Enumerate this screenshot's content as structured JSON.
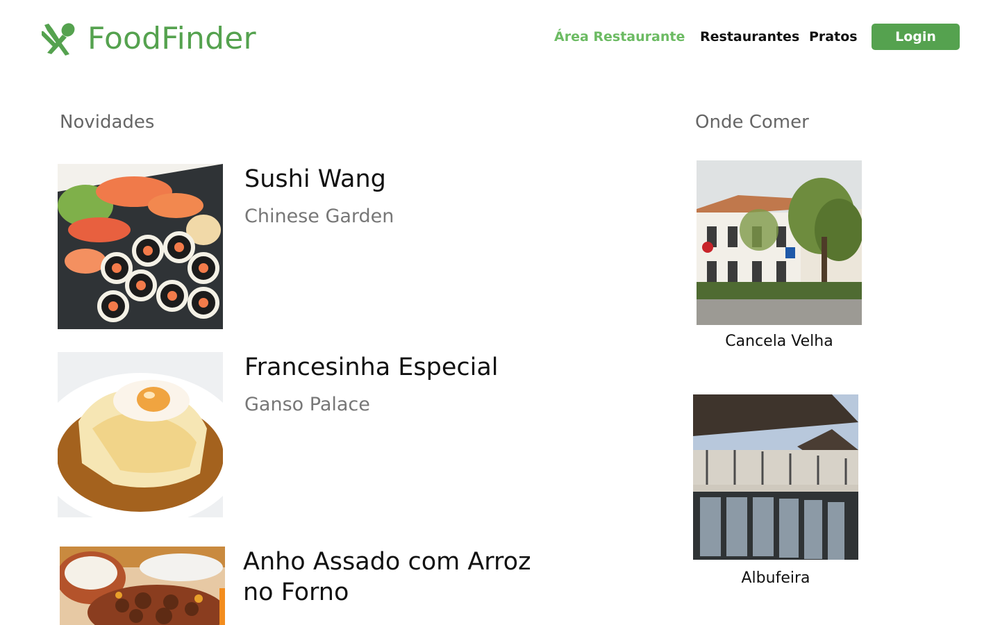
{
  "brand": {
    "name": "FoodFinder",
    "color": "#55a24f",
    "icon": "fork-knife-icon"
  },
  "nav": {
    "area_restaurante": "Área Restaurante",
    "restaurantes": "Restaurantes",
    "pratos": "Pratos",
    "login": "Login"
  },
  "novidades": {
    "title": "Novidades",
    "items": [
      {
        "dish": "Sushi Wang",
        "restaurant": "Chinese Garden",
        "image": "sushi-platter-photo"
      },
      {
        "dish": "Francesinha Especial",
        "restaurant": "Ganso Palace",
        "image": "francesinha-photo"
      },
      {
        "dish": "Anho Assado com Arroz no Forno",
        "restaurant": "",
        "image": "roast-lamb-photo"
      }
    ]
  },
  "onde_comer": {
    "title": "Onde Comer",
    "places": [
      {
        "name": "Cancela Velha",
        "image": "building-photo"
      },
      {
        "name": "Albufeira",
        "image": "terrace-photo"
      }
    ]
  }
}
